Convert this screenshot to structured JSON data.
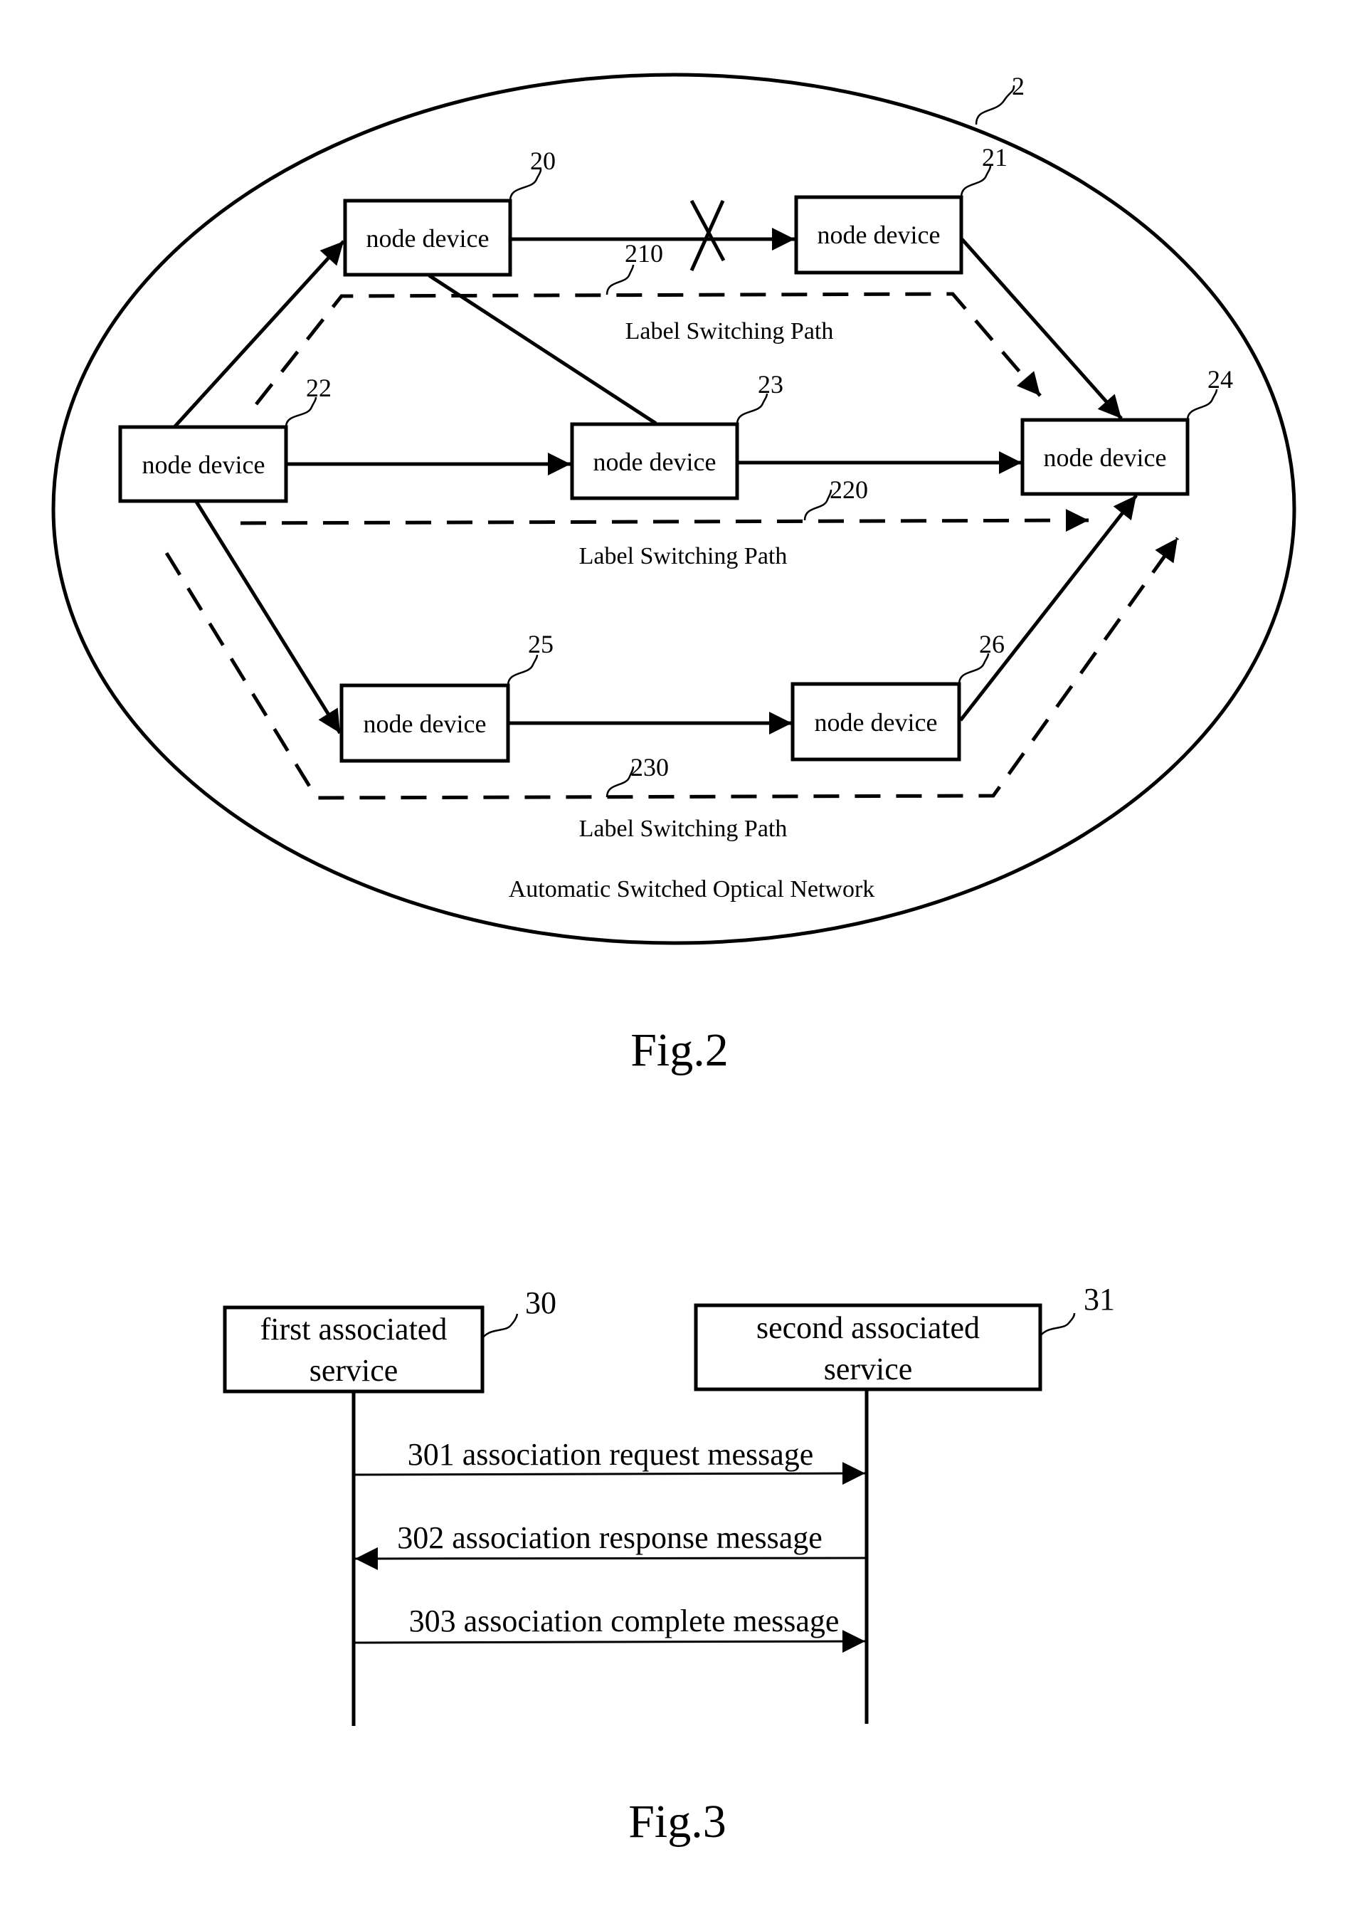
{
  "figure2": {
    "caption": "Fig.2",
    "network": {
      "ref": "2",
      "label": "Automatic Switched Optical Network"
    },
    "nodes": [
      {
        "id": "20",
        "label": "node device"
      },
      {
        "id": "21",
        "label": "node device"
      },
      {
        "id": "22",
        "label": "node device"
      },
      {
        "id": "23",
        "label": "node device"
      },
      {
        "id": "24",
        "label": "node device"
      },
      {
        "id": "25",
        "label": "node device"
      },
      {
        "id": "26",
        "label": "node device"
      }
    ],
    "links": [
      {
        "from": "22",
        "to": "20",
        "directed": true
      },
      {
        "from": "20",
        "to": "21",
        "directed": true,
        "failed": true
      },
      {
        "from": "21",
        "to": "24",
        "directed": true
      },
      {
        "from": "20",
        "to": "23",
        "directed": false
      },
      {
        "from": "22",
        "to": "23",
        "directed": true
      },
      {
        "from": "23",
        "to": "24",
        "directed": true
      },
      {
        "from": "22",
        "to": "25",
        "directed": true
      },
      {
        "from": "25",
        "to": "26",
        "directed": true
      },
      {
        "from": "26",
        "to": "24",
        "directed": true
      }
    ],
    "label_switching_paths": [
      {
        "ref": "210",
        "label": "Label Switching Path",
        "via": [
          "22",
          "20",
          "21",
          "24"
        ]
      },
      {
        "ref": "220",
        "label": "Label Switching Path",
        "via": [
          "22",
          "23",
          "24"
        ]
      },
      {
        "ref": "230",
        "label": "Label Switching Path",
        "via": [
          "22",
          "25",
          "26",
          "24"
        ]
      }
    ]
  },
  "figure3": {
    "caption": "Fig.3",
    "participants": [
      {
        "ref": "30",
        "line1": "first associated",
        "line2": "service"
      },
      {
        "ref": "31",
        "line1": "second associated",
        "line2": "service"
      }
    ],
    "messages": [
      {
        "label": "301 association request message",
        "from": "30",
        "to": "31"
      },
      {
        "label": "302 association response message",
        "from": "31",
        "to": "30"
      },
      {
        "label": "303 association complete message",
        "from": "30",
        "to": "31"
      }
    ]
  }
}
